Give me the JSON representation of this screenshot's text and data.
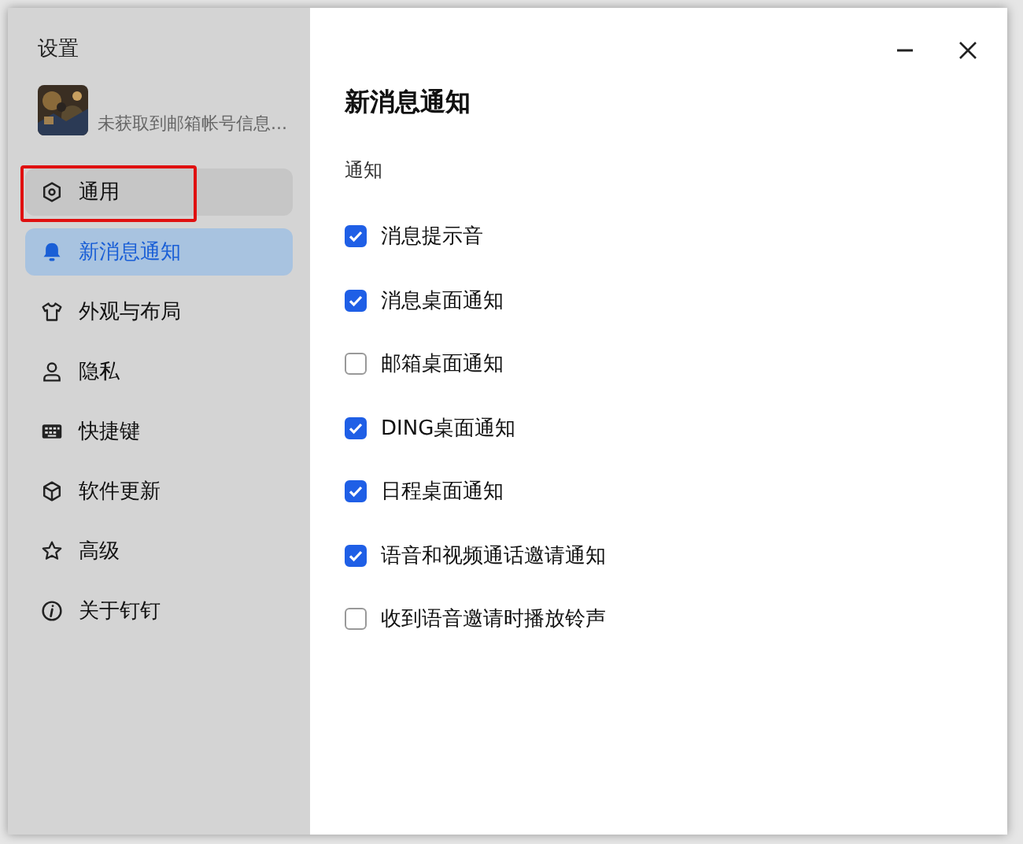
{
  "window": {
    "title": "设置"
  },
  "account": {
    "status": "未获取到邮箱帐号信息..."
  },
  "sidebar": {
    "items": [
      {
        "label": "通用",
        "selected": false,
        "hovered": true,
        "highlighted": true
      },
      {
        "label": "新消息通知",
        "selected": true,
        "hovered": false,
        "highlighted": false
      },
      {
        "label": "外观与布局",
        "selected": false,
        "hovered": false,
        "highlighted": false
      },
      {
        "label": "隐私",
        "selected": false,
        "hovered": false,
        "highlighted": false
      },
      {
        "label": "快捷键",
        "selected": false,
        "hovered": false,
        "highlighted": false
      },
      {
        "label": "软件更新",
        "selected": false,
        "hovered": false,
        "highlighted": false
      },
      {
        "label": "高级",
        "selected": false,
        "hovered": false,
        "highlighted": false
      },
      {
        "label": "关于钉钉",
        "selected": false,
        "hovered": false,
        "highlighted": false
      }
    ]
  },
  "content": {
    "heading": "新消息通知",
    "section": "通知",
    "options": [
      {
        "label": "消息提示音",
        "checked": true
      },
      {
        "label": "消息桌面通知",
        "checked": true
      },
      {
        "label": "邮箱桌面通知",
        "checked": false
      },
      {
        "label": "DING桌面通知",
        "checked": true
      },
      {
        "label": "日程桌面通知",
        "checked": true
      },
      {
        "label": "语音和视频通话邀请通知",
        "checked": true
      },
      {
        "label": "收到语音邀请时播放铃声",
        "checked": false
      }
    ]
  }
}
